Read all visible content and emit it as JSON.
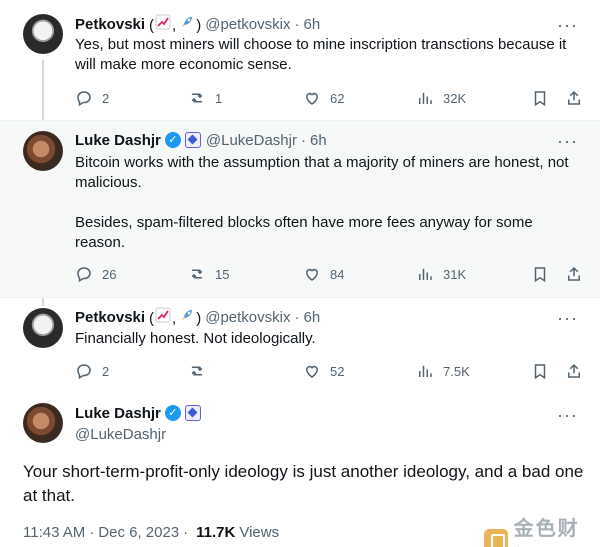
{
  "tweets": [
    {
      "name": "Petkovski",
      "emoji_open": "(",
      "emoji_close": ")",
      "emoji_icons": [
        "chart-up-icon",
        "rocket-icon"
      ],
      "handle": "@petkovskix",
      "time": "6h",
      "text": [
        "Yes, but most miners will choose to mine  inscription transctions because it will make more economic sense."
      ],
      "replies": "2",
      "retweets": "1",
      "likes": "62",
      "views": "32K"
    },
    {
      "name": "Luke Dashjr",
      "handle": "@LukeDashjr",
      "time": "6h",
      "text": [
        "Bitcoin works with the assumption that a majority of miners are honest, not malicious.",
        "Besides, spam-filtered blocks often have more fees anyway for some reason."
      ],
      "replies": "26",
      "retweets": "15",
      "likes": "84",
      "views": "31K"
    },
    {
      "name": "Petkovski",
      "emoji_open": "(",
      "emoji_close": ")",
      "emoji_icons": [
        "chart-up-icon",
        "rocket-icon"
      ],
      "handle": "@petkovskix",
      "time": "6h",
      "text": [
        "Financially honest. Not ideologically."
      ],
      "replies": "2",
      "retweets": "",
      "likes": "52",
      "views": "7.5K"
    }
  ],
  "main": {
    "name": "Luke Dashjr",
    "handle": "@LukeDashjr",
    "text": "Your short-term-profit-only ideology is just another ideology, and a bad one at that.",
    "time": "11:43 AM",
    "date": "Dec 6, 2023",
    "views_count": "11.7K",
    "views_label": "Views"
  },
  "separator": "·",
  "watermark": {
    "text": "金色财经"
  },
  "colors": {
    "accent": "#1d9bf0",
    "muted": "#536471",
    "highlight_bg": "#f7f9f9"
  }
}
